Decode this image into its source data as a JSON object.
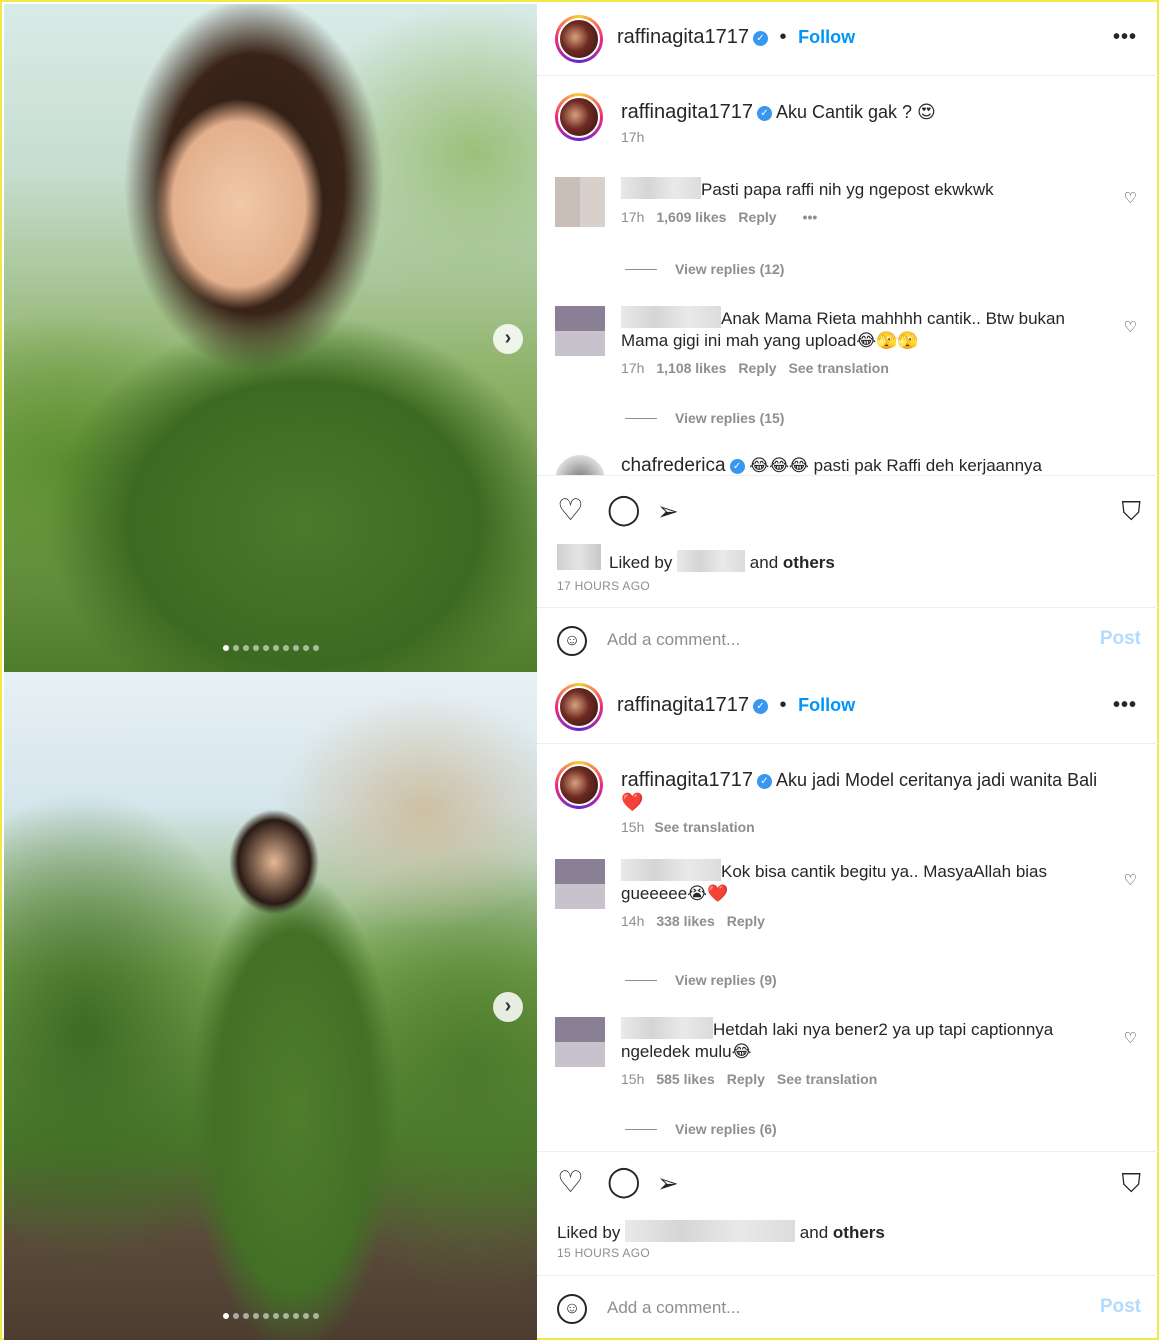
{
  "posts": [
    {
      "username": "raffinagita1717",
      "follow_label": "Follow",
      "more_label": "•••",
      "caption": "Aku Cantik gak ? 😍",
      "caption_time": "17h",
      "caption_extra": "",
      "carousel": {
        "count": 10,
        "active": 1,
        "next_label": "›"
      },
      "comments": [
        {
          "text": "Pasti papa raffi nih yg ngepost ekwkwk",
          "time": "17h",
          "likes": "1,609 likes",
          "reply": "Reply",
          "extra": "•••",
          "view_replies": "View replies (12)"
        },
        {
          "text": "Anak Mama Rieta mahhhh cantik.. Btw bukan Mama gigi ini mah yang upload😂🫣🫣",
          "time": "17h",
          "likes": "1,108 likes",
          "reply": "Reply",
          "extra": "See translation",
          "view_replies": "View replies (15)"
        },
        {
          "username": "chafrederica",
          "text": "😂😂😂 pasti pak Raffi deh kerjaannya"
        }
      ],
      "liked_by_prefix": "Liked by",
      "liked_by_suffix": "and",
      "liked_by_others": "others",
      "posted_ago": "17 HOURS AGO",
      "add_comment_placeholder": "Add a comment...",
      "post_label": "Post"
    },
    {
      "username": "raffinagita1717",
      "follow_label": "Follow",
      "more_label": "•••",
      "caption": "Aku jadi Model ceritanya jadi wanita Bali",
      "caption_extra": "❤️",
      "caption_time": "15h",
      "see_translation": "See translation",
      "carousel": {
        "count": 10,
        "active": 1,
        "next_label": "›"
      },
      "comments": [
        {
          "text": "Kok bisa cantik begitu ya.. MasyaAllah bias gueeeee😭❤️",
          "time": "14h",
          "likes": "338 likes",
          "reply": "Reply",
          "extra": "",
          "view_replies": "View replies (9)"
        },
        {
          "text": "Hetdah laki nya bener2 ya up tapi captionnya ngeledek mulu😂",
          "time": "15h",
          "likes": "585 likes",
          "reply": "Reply",
          "extra": "See translation",
          "view_replies": "View replies (6)"
        }
      ],
      "liked_by_prefix": "Liked by",
      "liked_by_suffix": "and",
      "liked_by_others": "others",
      "posted_ago": "15 HOURS AGO",
      "add_comment_placeholder": "Add a comment...",
      "post_label": "Post"
    }
  ],
  "icons": {
    "verified": "verified-badge-icon",
    "like": "heart-icon",
    "comment": "comment-icon",
    "share": "paper-plane-icon",
    "save": "bookmark-icon",
    "emoji": "smile-icon"
  },
  "colors": {
    "accent": "#0095f6",
    "post_disabled": "#b3dbff",
    "verified": "#3897f0"
  }
}
